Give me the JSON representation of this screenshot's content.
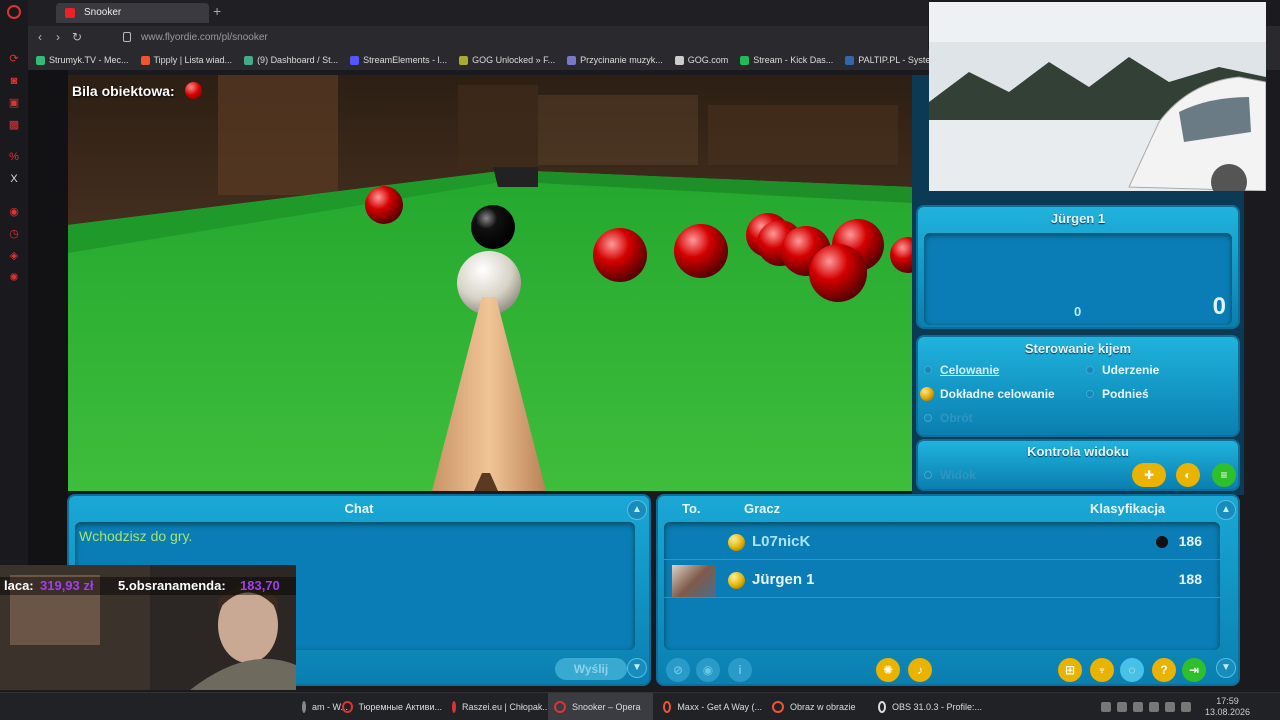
{
  "browser": {
    "tab_title": "Snooker",
    "url": "www.flyordie.com/pl/snooker",
    "bookmarks": [
      "Strumyk.TV - Mec...",
      "Tipply | Lista wiad...",
      "(9) Dashboard / St...",
      "StreamElements - l...",
      "GOG Unlocked » F...",
      "Przycinanie muzyk...",
      "GOG.com",
      "Stream - Kick Das...",
      "PALTIP.PL - Syste..."
    ]
  },
  "game": {
    "object_ball_label": "Bila obiektowa:",
    "score_panel": {
      "player_name": "Jürgen 1",
      "frame_score": "0",
      "total_score": "0"
    },
    "cue_control": {
      "title": "Sterowanie kijem",
      "options": {
        "aiming": "Celowanie",
        "strike": "Uderzenie",
        "fine_aiming": "Dokładne celowanie",
        "raise": "Podnieś",
        "rotation": "Obrót"
      }
    },
    "view_control": {
      "title": "Kontrola widoku",
      "view": "Widok"
    },
    "chat": {
      "title": "Chat",
      "message": "Wchodzisz do gry.",
      "send": "Wyślij"
    },
    "players": {
      "col_table": "To.",
      "col_player": "Gracz",
      "col_rank": "Klasyfikacja",
      "rows": [
        {
          "name": "L07nicK",
          "rank": "186"
        },
        {
          "name": "Jürgen 1",
          "rank": "188"
        }
      ]
    }
  },
  "overlay": {
    "donation_1_name": "laca:",
    "donation_1_amount": "319,93 zł",
    "donation_2_name": "5.obsranamenda:",
    "donation_2_amount": "183,70"
  },
  "taskbar": {
    "tasks": [
      "am - W...",
      "Тюремные Активи...",
      "Raszei.eu | Chłopak...",
      "Snooker – Opera",
      "Maxx - Get A Way (...",
      "Obraz w obrazie",
      "OBS 31.0.3 - Profile:..."
    ],
    "time": "17:59",
    "date": "13.08.2026"
  }
}
